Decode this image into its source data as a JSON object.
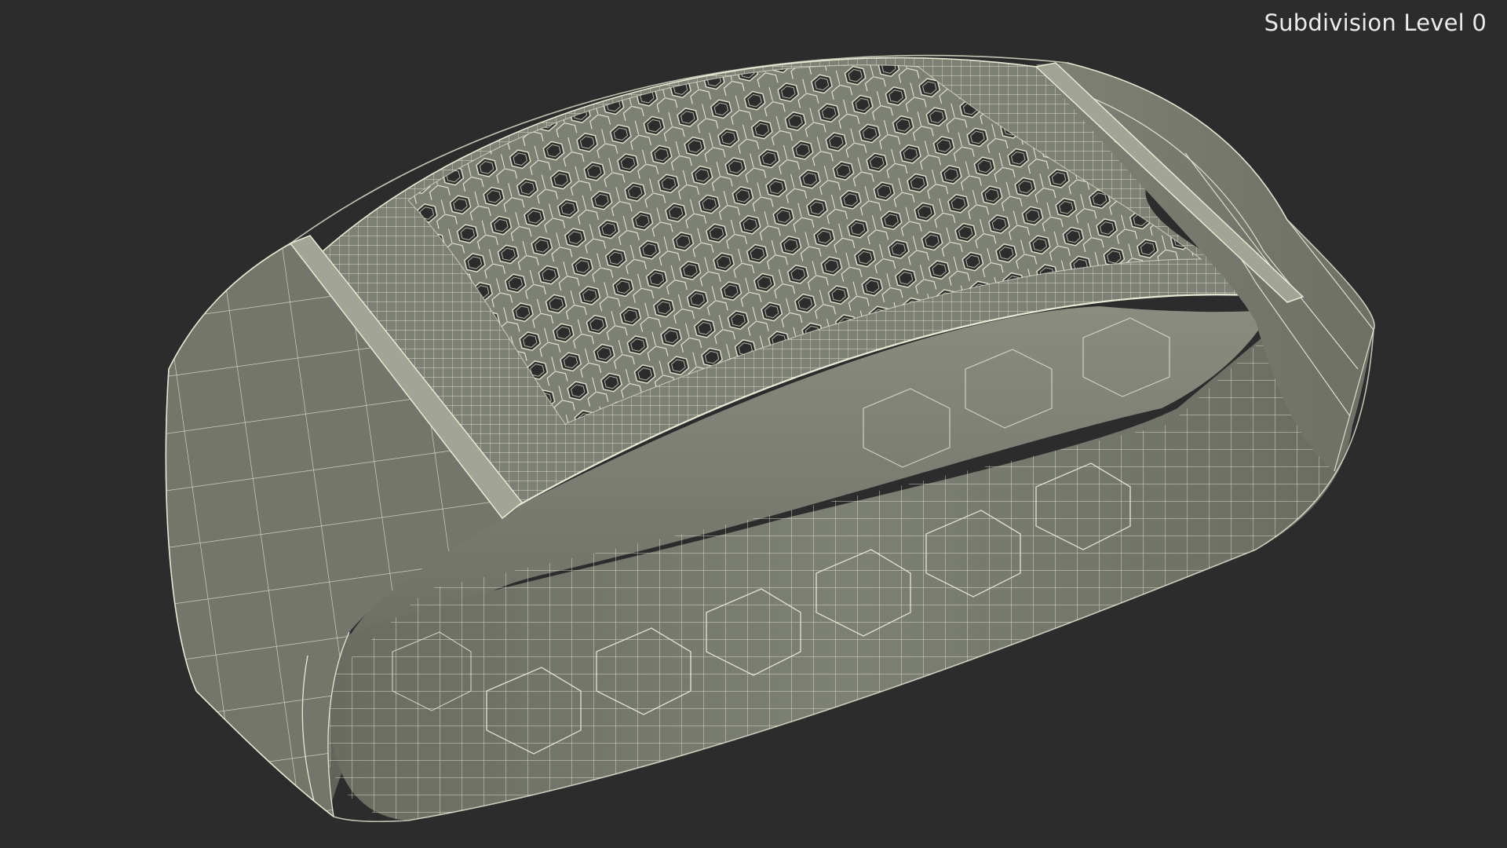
{
  "viewport": {
    "subdivision_label": "Subdivision Level 0",
    "background_color": "#2c2c2c",
    "mesh_fill_color": "#777a6e",
    "wire_color": "#e8ead6"
  },
  "model": {
    "name_icon": "wireframe-wristband-icon"
  }
}
